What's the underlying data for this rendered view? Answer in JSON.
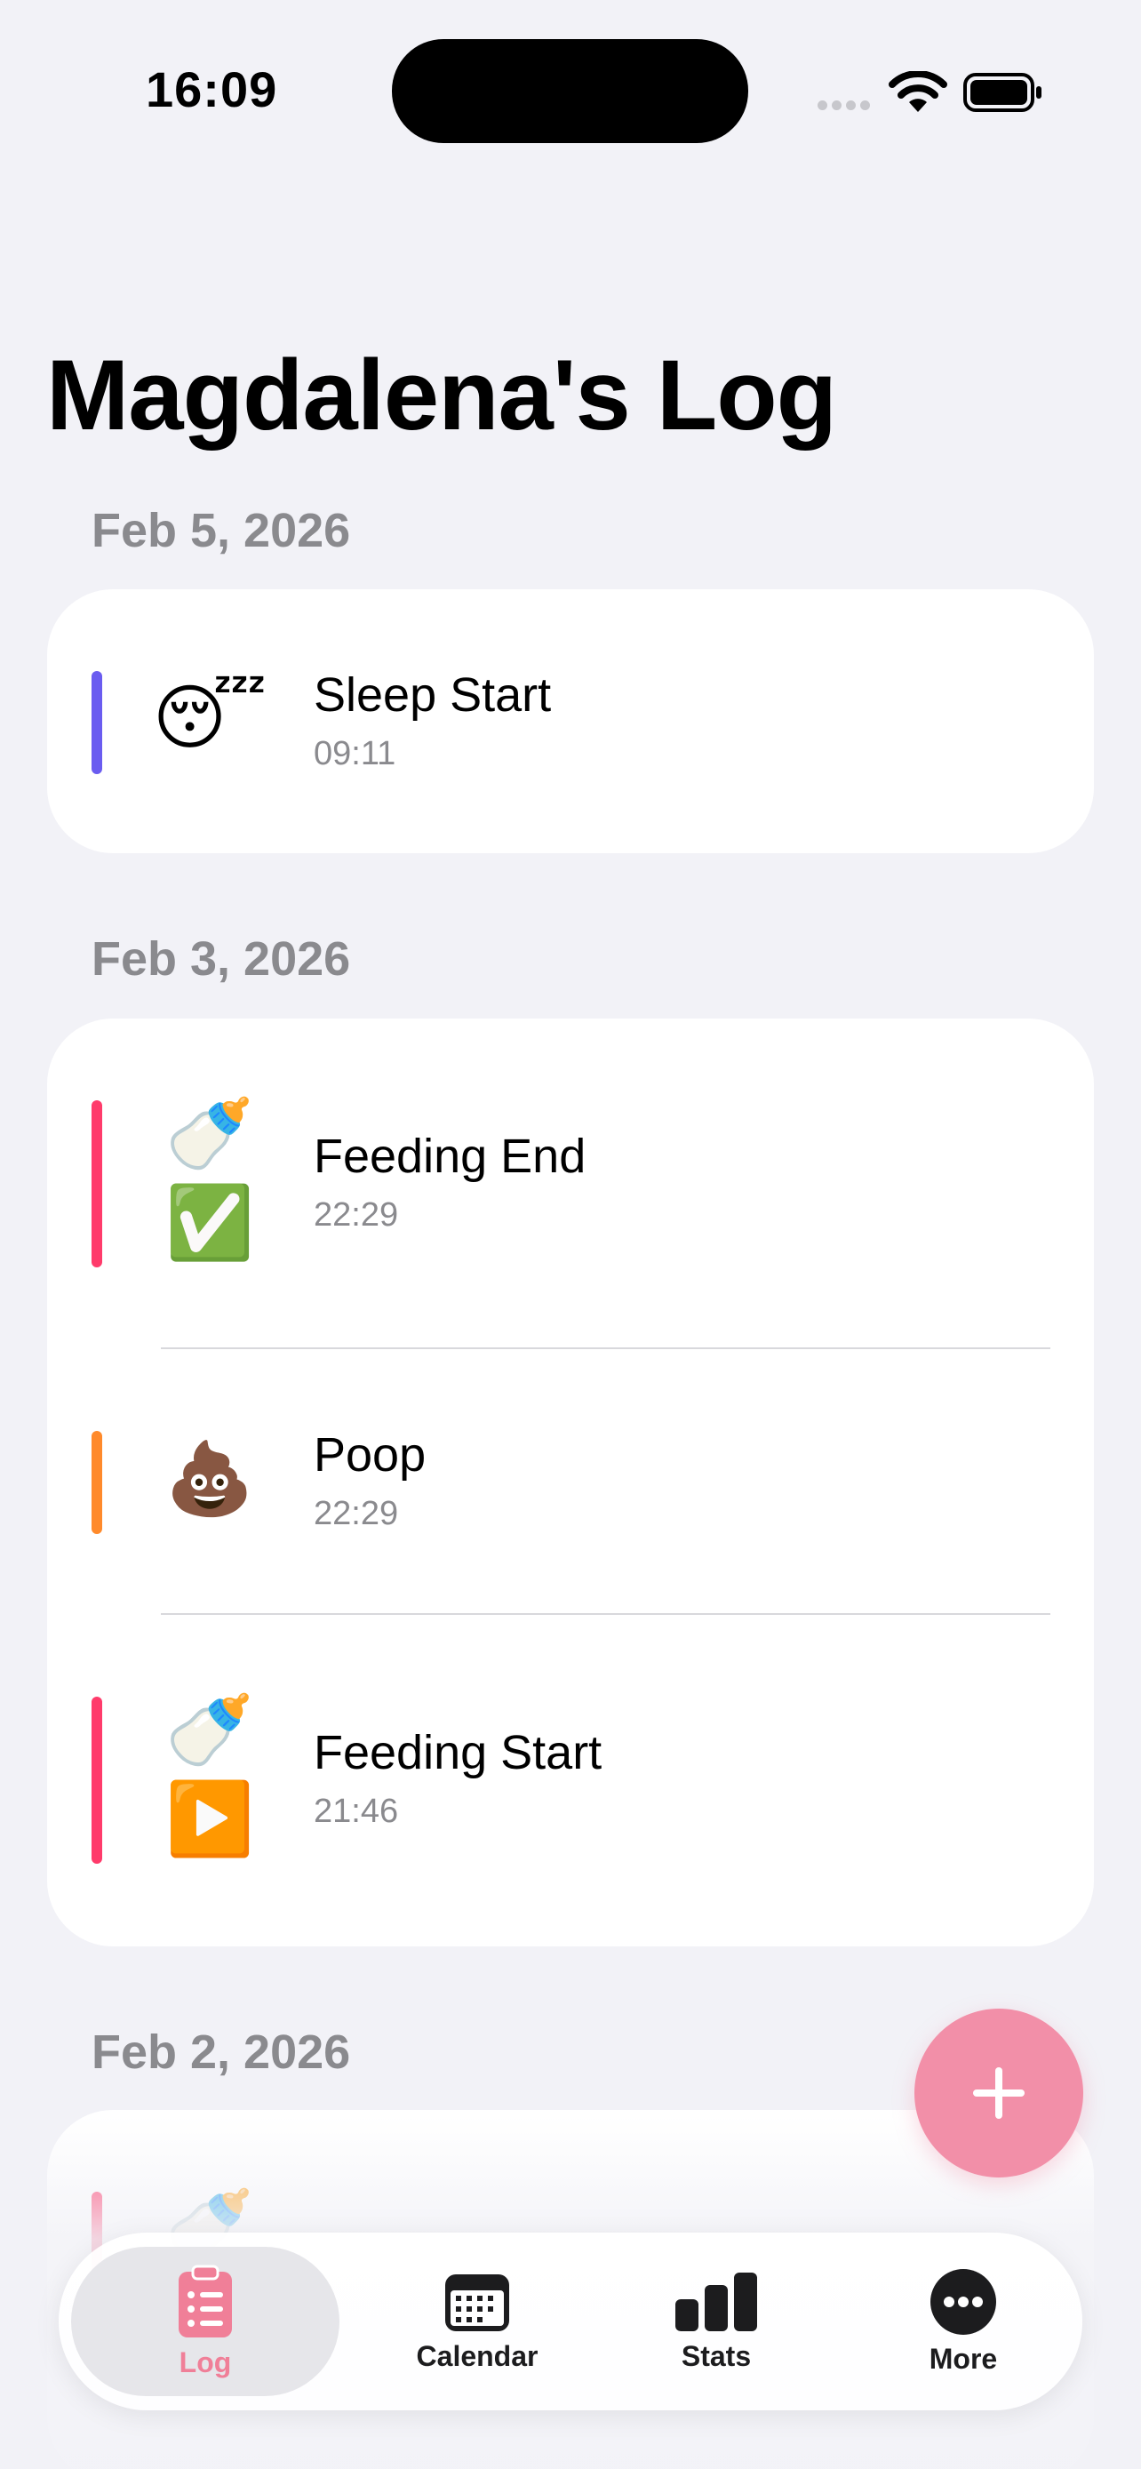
{
  "status_bar": {
    "time": "16:09"
  },
  "page_title": "Magdalena's Log",
  "sections": [
    {
      "date": "Feb 5, 2026",
      "entries": [
        {
          "title": "Sleep Start",
          "time": "09:11",
          "emoji": "😴",
          "emoji2": "",
          "accent": "#6a5cf0"
        }
      ]
    },
    {
      "date": "Feb 3, 2026",
      "entries": [
        {
          "title": "Feeding End",
          "time": "22:29",
          "emoji": "🍼",
          "emoji2": "✅",
          "accent": "#ff3b6b"
        },
        {
          "title": "Poop",
          "time": "22:29",
          "emoji": "💩",
          "emoji2": "",
          "accent": "#ff8a2b"
        },
        {
          "title": "Feeding Start",
          "time": "21:46",
          "emoji": "🍼",
          "emoji2": "▶️",
          "accent": "#ff3b6b"
        }
      ]
    },
    {
      "date": "Feb 2, 2026",
      "entries": [
        {
          "title": "",
          "time": "",
          "emoji": "🍼",
          "emoji2": "",
          "accent": "#ff3b6b"
        }
      ]
    }
  ],
  "fab": {
    "icon": "plus-icon"
  },
  "tabs": [
    {
      "label": "Log",
      "icon": "clipboard-icon",
      "active": true,
      "color": "#f07f98"
    },
    {
      "label": "Calendar",
      "icon": "calendar-icon",
      "active": false,
      "color": "#1c1c1e"
    },
    {
      "label": "Stats",
      "icon": "chart-bar-icon",
      "active": false,
      "color": "#1c1c1e"
    },
    {
      "label": "More",
      "icon": "ellipsis-icon",
      "active": false,
      "color": "#1c1c1e"
    }
  ]
}
